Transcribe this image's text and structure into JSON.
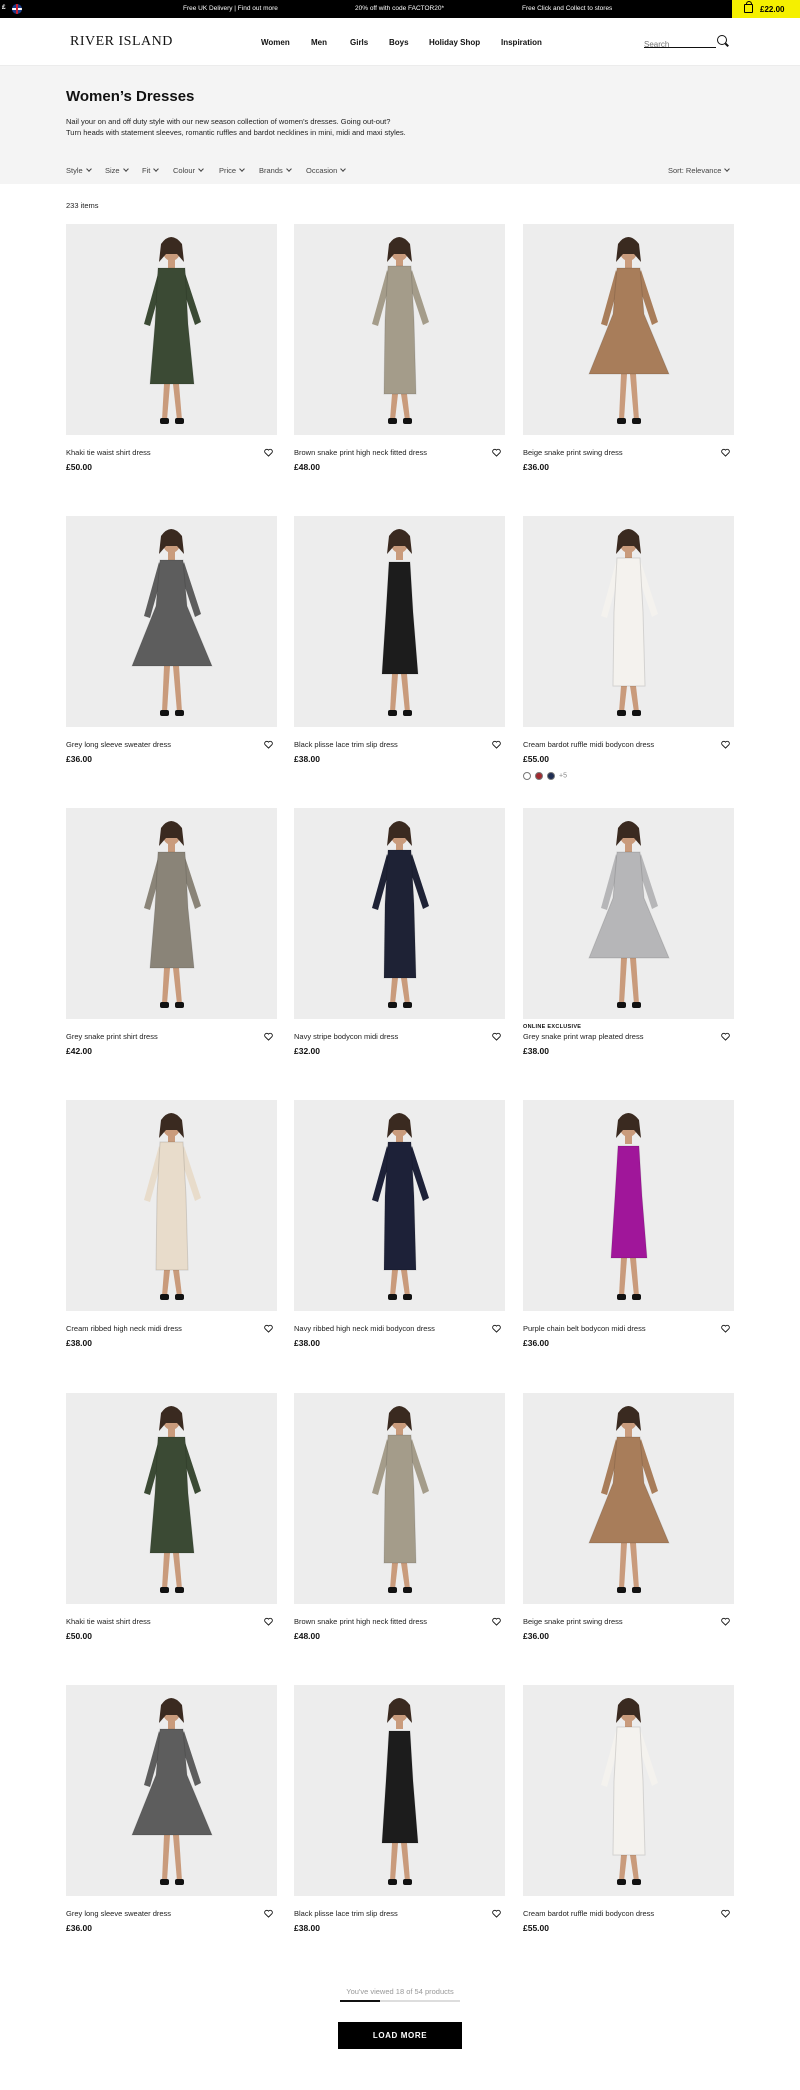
{
  "topbar": {
    "currency": "£",
    "promos": [
      "Free UK Delivery | Find out more",
      "20% off with code FACTOR20*",
      "Free Click and Collect to stores"
    ],
    "basket_total": "£22.00",
    "basket_color": "#f5f000"
  },
  "header": {
    "logo": "RIVER ISLAND",
    "nav": [
      "Women",
      "Men",
      "Girls",
      "Boys",
      "Holiday Shop",
      "Inspiration"
    ],
    "search_placeholder": "Search"
  },
  "category": {
    "title": "Women’s Dresses",
    "intro_line1": "Nail your on and off duty style with our new season collection of women's dresses. Going out-out?",
    "intro_line2": "Turn heads with statement sleeves, romantic ruffles and bardot necklines in mini, midi and maxi styles.",
    "filters": [
      "Style",
      "Size",
      "Fit",
      "Colour",
      "Price",
      "Brands",
      "Occasion"
    ],
    "sort": "Sort: Relevance"
  },
  "item_count": "233 items",
  "products": [
    {
      "name": "Khaki tie waist shirt dress",
      "price": "£50.00",
      "color": "#3b4a34",
      "style": "shirt"
    },
    {
      "name": "Brown snake print high neck fitted dress",
      "price": "£48.00",
      "color": "#a49c8a",
      "style": "bodycon"
    },
    {
      "name": "Beige snake print swing dress",
      "price": "£36.00",
      "color": "#a87d5a",
      "style": "swing"
    },
    {
      "name": "Grey long sleeve sweater dress",
      "price": "£36.00",
      "color": "#5d5d5d",
      "style": "skater"
    },
    {
      "name": "Black plisse lace trim slip dress",
      "price": "£38.00",
      "color": "#1c1c1c",
      "style": "slip"
    },
    {
      "name": "Cream bardot ruffle midi bodycon dress",
      "price": "£55.00",
      "color": "#f4f2ee",
      "style": "bodycon",
      "swatches": [
        "#ffffff",
        "#a02a30",
        "#1f2d52"
      ],
      "more": "+5"
    },
    {
      "name": "Grey snake print shirt dress",
      "price": "£42.00",
      "color": "#8a8478",
      "style": "shirt"
    },
    {
      "name": "Navy stripe bodycon midi dress",
      "price": "£32.00",
      "color": "#1e2235",
      "style": "bodycon"
    },
    {
      "name": "Grey snake print wrap pleated dress",
      "price": "£38.00",
      "color": "#b6b6b8",
      "style": "swing",
      "badge": "ONLINE EXCLUSIVE"
    },
    {
      "name": "Cream ribbed high neck midi dress",
      "price": "£38.00",
      "color": "#e8dccb",
      "style": "bodycon"
    },
    {
      "name": "Navy ribbed high neck midi bodycon dress",
      "price": "£38.00",
      "color": "#1d2138",
      "style": "bodycon"
    },
    {
      "name": "Purple chain belt bodycon midi dress",
      "price": "£36.00",
      "color": "#a0169a",
      "style": "slip"
    },
    {
      "name": "Khaki tie waist shirt dress",
      "price": "£50.00",
      "color": "#3b4a34",
      "style": "shirt"
    },
    {
      "name": "Brown snake print high neck fitted dress",
      "price": "£48.00",
      "color": "#a49c8a",
      "style": "bodycon"
    },
    {
      "name": "Beige snake print swing dress",
      "price": "£36.00",
      "color": "#a87d5a",
      "style": "swing"
    },
    {
      "name": "Grey long sleeve sweater dress",
      "price": "£36.00",
      "color": "#5d5d5d",
      "style": "skater"
    },
    {
      "name": "Black plisse lace trim slip dress",
      "price": "£38.00",
      "color": "#1c1c1c",
      "style": "slip"
    },
    {
      "name": "Cream bardot ruffle midi bodycon dress",
      "price": "£55.00",
      "color": "#f4f2ee",
      "style": "bodycon"
    }
  ],
  "footer": {
    "viewed_text": "You've viewed 18 of 54 products",
    "viewed_fraction": 0.333,
    "load_more": "LOAD MORE"
  }
}
